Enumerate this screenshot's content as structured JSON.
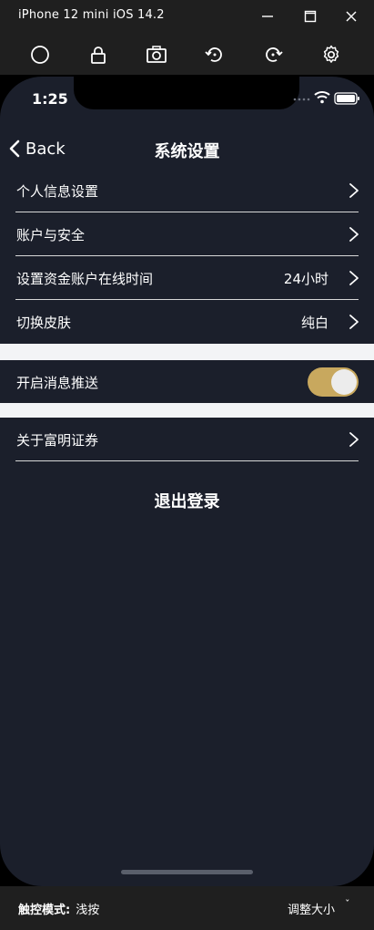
{
  "window": {
    "title": "iPhone 12 mini iOS 14.2",
    "controls": [
      "minimize-icon",
      "maximize-icon",
      "close-icon"
    ]
  },
  "toolbar": {
    "icons": [
      "home-circle-icon",
      "lock-icon",
      "camera-icon",
      "rotate-left-icon",
      "rotate-right-icon",
      "gear-icon"
    ]
  },
  "status_bar": {
    "time": "1:25"
  },
  "nav": {
    "back_label": "Back",
    "title": "系统设置"
  },
  "settings": {
    "personal_info": "个人信息设置",
    "account_security": "账户与安全",
    "fund_online_label": "设置资金账户在线时间",
    "fund_online_value": "24小时",
    "skin_label": "切换皮肤",
    "skin_value": "纯白",
    "push_label": "开启消息推送",
    "push_enabled": true,
    "about_label": "关于富明证券",
    "logout_label": "退出登录"
  },
  "bottom_bar": {
    "touch_mode_label": "触控模式:",
    "touch_mode_value": "浅按",
    "resize_label": "调整大小",
    "resize_caret": "ˇ"
  },
  "colors": {
    "screen_bg": "#1b1f2b",
    "toggle_on": "#c8a85e",
    "section_gap": "#f3f4f6",
    "chrome_bg": "#1f1f1f"
  }
}
